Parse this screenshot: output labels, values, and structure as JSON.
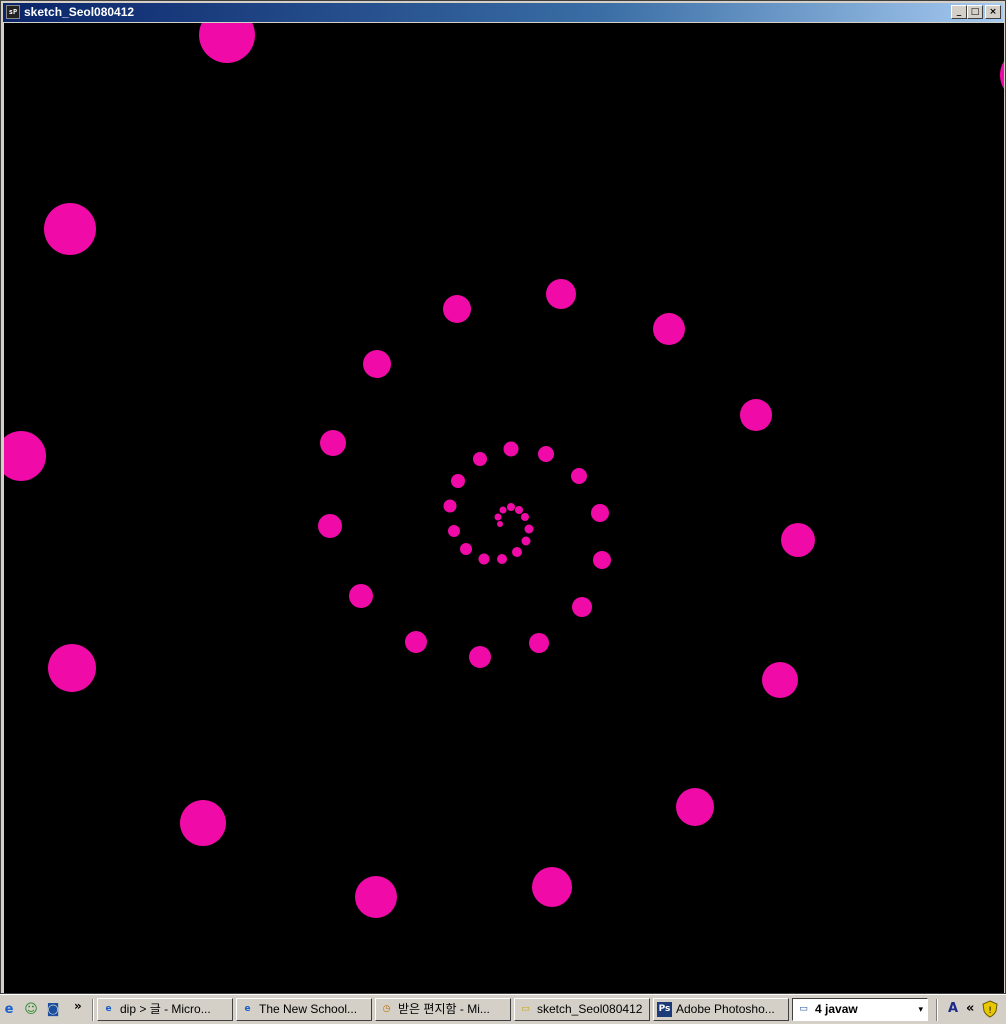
{
  "window": {
    "title": "sketch_Seol080412",
    "app_icon": "processing-icon",
    "app_icon_text": "sP",
    "controls": {
      "minimize": "_",
      "maximize": "□",
      "close": "×"
    }
  },
  "sketch": {
    "background": "#000000",
    "dot_color": "#f00aa8",
    "dot_count": 44,
    "pattern": "spiral"
  },
  "taskbar": {
    "quick_launch": [
      {
        "icon": "internet-explorer-icon",
        "glyph": "e"
      },
      {
        "icon": "messenger-icon",
        "glyph": "☺"
      },
      {
        "icon": "desktop-icon",
        "glyph": "◙"
      }
    ],
    "more": "»",
    "tasks": [
      {
        "label": "dip > 글 - Micro...",
        "icon": "internet-explorer-icon",
        "glyph": "e"
      },
      {
        "label": "The New School...",
        "icon": "internet-explorer-icon",
        "glyph": "e"
      },
      {
        "label": "받은 편지함 - Mi...",
        "icon": "outlook-icon",
        "glyph": "◷"
      },
      {
        "label": "sketch_Seol080412",
        "icon": "folder-icon",
        "glyph": "▭"
      },
      {
        "label": "Adobe Photosho...",
        "icon": "photoshop-icon",
        "glyph": "Ps"
      },
      {
        "label": "4 javaw",
        "icon": "window-icon",
        "glyph": "▭",
        "dropdown": "▾"
      }
    ],
    "tray": {
      "ime": "A",
      "expand": "«",
      "shield": "shield-icon"
    }
  }
}
